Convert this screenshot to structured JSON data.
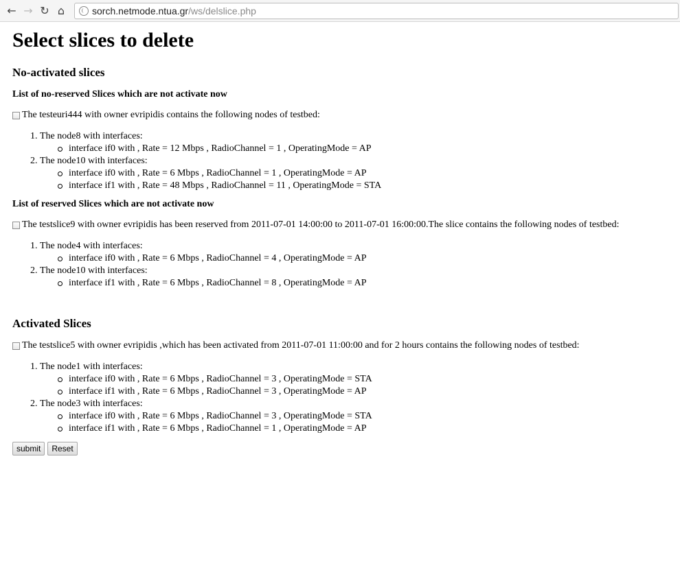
{
  "browser": {
    "url_host": "sorch.netmode.ntua.gr",
    "url_path": "/ws/delslice.php"
  },
  "page": {
    "title": "Select slices to delete",
    "no_activated": {
      "heading": "No-activated slices",
      "not_reserved": {
        "heading": "List of no-reserved Slices which are not activate now",
        "slice_text": "The testeuri444 with owner evripidis contains the following nodes of testbed:",
        "nodes": [
          {
            "label": "The node8 with interfaces:",
            "interfaces": [
              "interface if0 with , Rate = 12 Mbps , RadioChannel = 1 , OperatingMode = AP"
            ]
          },
          {
            "label": "The node10 with interfaces:",
            "interfaces": [
              "interface if0 with , Rate = 6 Mbps , RadioChannel = 1 , OperatingMode = AP",
              "interface if1 with , Rate = 48 Mbps , RadioChannel = 11 , OperatingMode = STA"
            ]
          }
        ]
      },
      "reserved": {
        "heading": "List of reserved Slices which are not activate now",
        "slice_text": "The testslice9 with owner evripidis has been reserved from 2011-07-01 14:00:00 to 2011-07-01 16:00:00.The slice contains the following nodes of testbed:",
        "nodes": [
          {
            "label": "The node4 with interfaces:",
            "interfaces": [
              "interface if0 with , Rate = 6 Mbps , RadioChannel = 4 , OperatingMode = AP"
            ]
          },
          {
            "label": "The node10 with interfaces:",
            "interfaces": [
              "interface if1 with , Rate = 6 Mbps , RadioChannel = 8 , OperatingMode = AP"
            ]
          }
        ]
      }
    },
    "activated": {
      "heading": "Activated Slices",
      "slice_text": "The testslice5 with owner evripidis ,which has been activated from 2011-07-01 11:00:00 and for 2 hours contains the following nodes of testbed:",
      "nodes": [
        {
          "label": "The node1 with interfaces:",
          "interfaces": [
            "interface if0 with , Rate = 6 Mbps , RadioChannel = 3 , OperatingMode = STA",
            "interface if1 with , Rate = 6 Mbps , RadioChannel = 3 , OperatingMode = AP"
          ]
        },
        {
          "label": "The node3 with interfaces:",
          "interfaces": [
            "interface if0 with , Rate = 6 Mbps , RadioChannel = 3 , OperatingMode = STA",
            "interface if1 with , Rate = 6 Mbps , RadioChannel = 1 , OperatingMode = AP"
          ]
        }
      ]
    },
    "buttons": {
      "submit": "submit",
      "reset": "Reset"
    }
  }
}
